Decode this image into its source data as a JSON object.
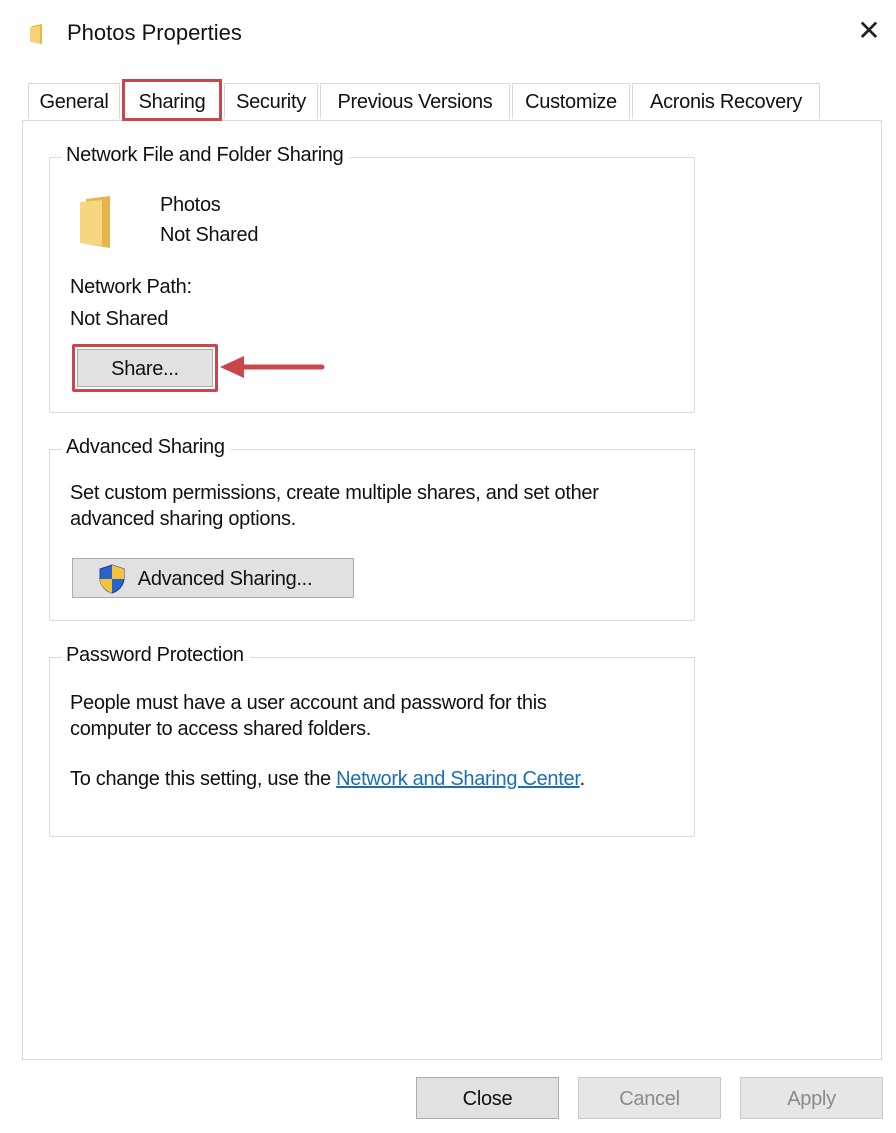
{
  "window": {
    "title": "Photos Properties",
    "close_glyph": "✕"
  },
  "tabs": [
    {
      "label": "General",
      "active": false
    },
    {
      "label": "Sharing",
      "active": true
    },
    {
      "label": "Security",
      "active": false
    },
    {
      "label": "Previous Versions",
      "active": false
    },
    {
      "label": "Customize",
      "active": false
    },
    {
      "label": "Acronis Recovery",
      "active": false
    }
  ],
  "network_sharing": {
    "group_title": "Network File and Folder Sharing",
    "folder_name": "Photos",
    "folder_status": "Not Shared",
    "path_label": "Network Path:",
    "path_value": "Not Shared",
    "share_button": "Share..."
  },
  "advanced_sharing": {
    "group_title": "Advanced Sharing",
    "description_line1": "Set custom permissions, create multiple shares, and set other",
    "description_line2": "advanced sharing options.",
    "button_label": "Advanced Sharing..."
  },
  "password_protection": {
    "group_title": "Password Protection",
    "description_line1": "People must have a user account and password for this",
    "description_line2": "computer to access shared folders.",
    "change_text": "To change this setting, use the ",
    "link_text": "Network and Sharing Center",
    "change_suffix": "."
  },
  "footer": {
    "close": "Close",
    "cancel": "Cancel",
    "apply": "Apply"
  },
  "colors": {
    "highlight": "#c8474c",
    "link": "#1c6fb0",
    "folder": "#f2cf6b"
  },
  "icons": [
    "folder-icon",
    "close-icon",
    "shield-icon",
    "arrow-icon"
  ]
}
